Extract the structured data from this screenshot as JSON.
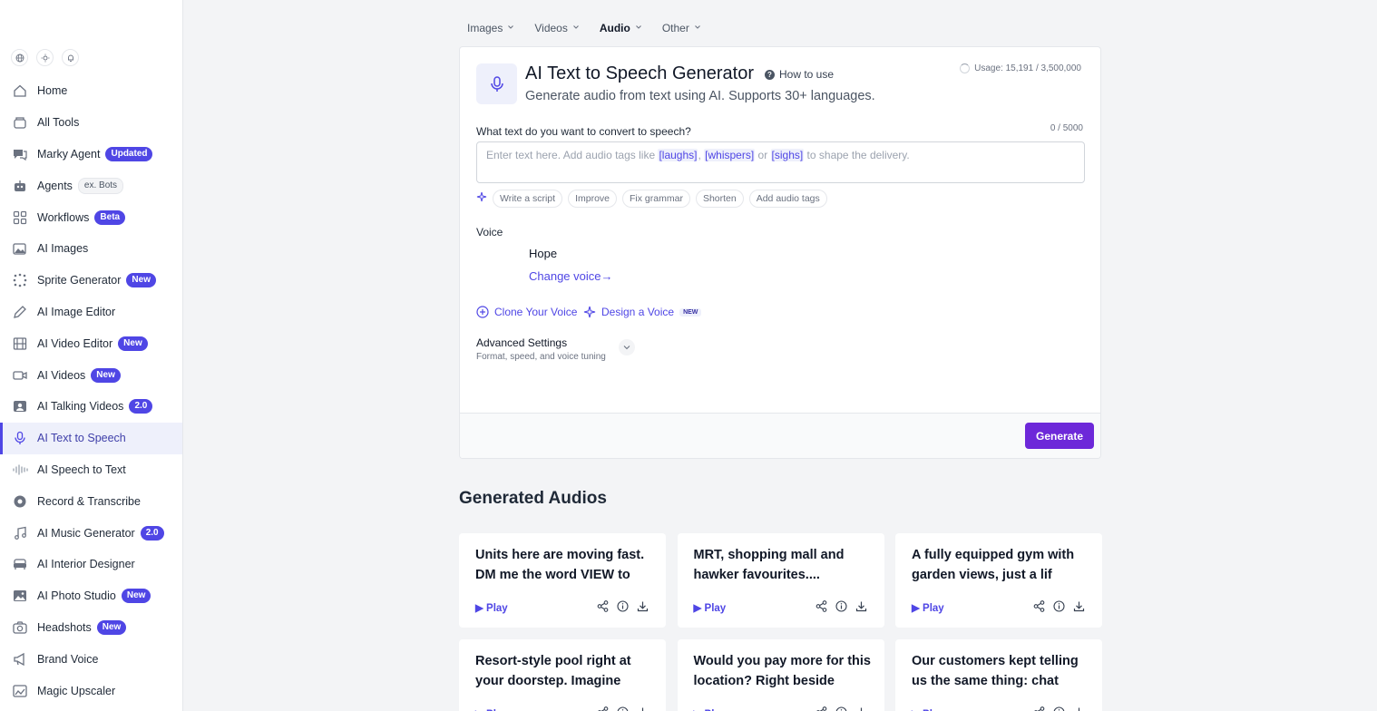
{
  "sidebar": {
    "items": [
      {
        "label": "Home",
        "icon": "home-icon",
        "badge": ""
      },
      {
        "label": "All Tools",
        "icon": "layers-icon",
        "badge": ""
      },
      {
        "label": "Marky Agent",
        "icon": "chat-icon",
        "badge": "Updated"
      },
      {
        "label": "Agents",
        "icon": "robot-icon",
        "badge": "ex. Bots"
      },
      {
        "label": "Workflows",
        "icon": "workflow-icon",
        "badge": "Beta"
      },
      {
        "label": "AI Images",
        "icon": "images-icon",
        "badge": ""
      },
      {
        "label": "Sprite Generator",
        "icon": "sprite-icon",
        "badge": "New"
      },
      {
        "label": "AI Image Editor",
        "icon": "pencil-icon",
        "badge": ""
      },
      {
        "label": "AI Video Editor",
        "icon": "film-icon",
        "badge": "New"
      },
      {
        "label": "AI Videos",
        "icon": "video-icon",
        "badge": "New"
      },
      {
        "label": "AI Talking Videos",
        "icon": "talking-head-icon",
        "badge": "2.0"
      },
      {
        "label": "AI Text to Speech",
        "icon": "mic-icon",
        "badge": ""
      },
      {
        "label": "AI Speech to Text",
        "icon": "waveform-icon",
        "badge": ""
      },
      {
        "label": "Record & Transcribe",
        "icon": "record-icon",
        "badge": ""
      },
      {
        "label": "AI Music Generator",
        "icon": "music-icon",
        "badge": "2.0"
      },
      {
        "label": "AI Interior Designer",
        "icon": "sofa-icon",
        "badge": ""
      },
      {
        "label": "AI Photo Studio",
        "icon": "photo-studio-icon",
        "badge": "New"
      },
      {
        "label": "Headshots",
        "icon": "camera-icon",
        "badge": "New"
      },
      {
        "label": "Brand Voice",
        "icon": "megaphone-icon",
        "badge": ""
      },
      {
        "label": "Magic Upscaler",
        "icon": "upscale-icon",
        "badge": ""
      }
    ]
  },
  "tabs": [
    "Images",
    "Videos",
    "Audio",
    "Other"
  ],
  "main": {
    "title": "AI Text to Speech Generator",
    "how_to_use": "How to use",
    "subtitle": "Generate audio from text using AI. Supports 30+ languages.",
    "usage": "Usage: 15,191 / 3,500,000",
    "input_label": "What text do you want to convert to speech?",
    "char_count": "0 / 5000",
    "placeholder_a": "Enter text here. Add audio tags like ",
    "tag1": "[laughs]",
    "sep1": ", ",
    "tag2": "[whispers]",
    "sep2": " or ",
    "tag3": "[sighs]",
    "placeholder_b": " to shape the delivery.",
    "chips": [
      "Write a script",
      "Improve",
      "Fix grammar",
      "Shorten",
      "Add audio tags"
    ],
    "voice_label": "Voice",
    "voice_name": "Hope",
    "change_voice": "Change voice→",
    "clone_voice": "Clone Your Voice",
    "design_voice": "Design a Voice",
    "design_badge": "NEW",
    "advanced_title": "Advanced Settings",
    "advanced_sub": "Format, speed, and voice tuning",
    "generate": "Generate"
  },
  "generated": {
    "title": "Generated Audios",
    "play_label": "▶ Play",
    "items": [
      "Units here are moving fast. DM me the word VIEW to",
      "MRT, shopping mall and hawker favourites....",
      "A fully equipped gym with garden views, just a lif",
      "Resort-style pool right at your doorstep. Imagine",
      "Would you pay more for this location? Right beside",
      "Our customers kept telling us the same thing: chat"
    ]
  },
  "colors": {
    "accent": "#4f46e5",
    "generate": "#6d28d9",
    "active_bg": "#eef0fb"
  }
}
